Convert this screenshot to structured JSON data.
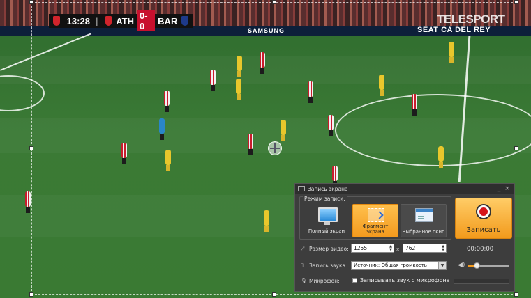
{
  "scoreboard": {
    "clock": "13:28",
    "home": "ATH",
    "score": "0-0",
    "away": "BAR",
    "home_color": "#d1242c",
    "away_color": "#1e3a8a"
  },
  "broadcaster_logo": "TELESPORT",
  "adboard": {
    "sponsor_center": "SAMSUNG",
    "sponsor_right": "SEAT   CA DEL REY"
  },
  "recorder": {
    "title": "Запись экрана",
    "window_buttons": {
      "minimize": "_",
      "close": "×"
    },
    "mode_group_label": "Режим записи:",
    "modes": [
      {
        "label": "Полный экран",
        "icon": "monitor-icon",
        "selected": false
      },
      {
        "label": "Фрагмент экрана",
        "icon": "region-select-icon",
        "selected": true
      },
      {
        "label": "Выбранное окно",
        "icon": "window-icon",
        "selected": false
      }
    ],
    "record_button_label": "Записать",
    "video_size_label": "Размер видео:",
    "width_value": "1255",
    "height_value": "762",
    "times_symbol": "x",
    "timer": "00:00:00",
    "audio_label": "Запись звука:",
    "audio_source": "Источник: Общая громкость",
    "mic_label": "Микрофон:",
    "mic_checkbox_label": "Записывать звук с микрофона",
    "mic_checked": false,
    "volume_fraction": 0.2,
    "accent_color": "#f39a1e"
  }
}
